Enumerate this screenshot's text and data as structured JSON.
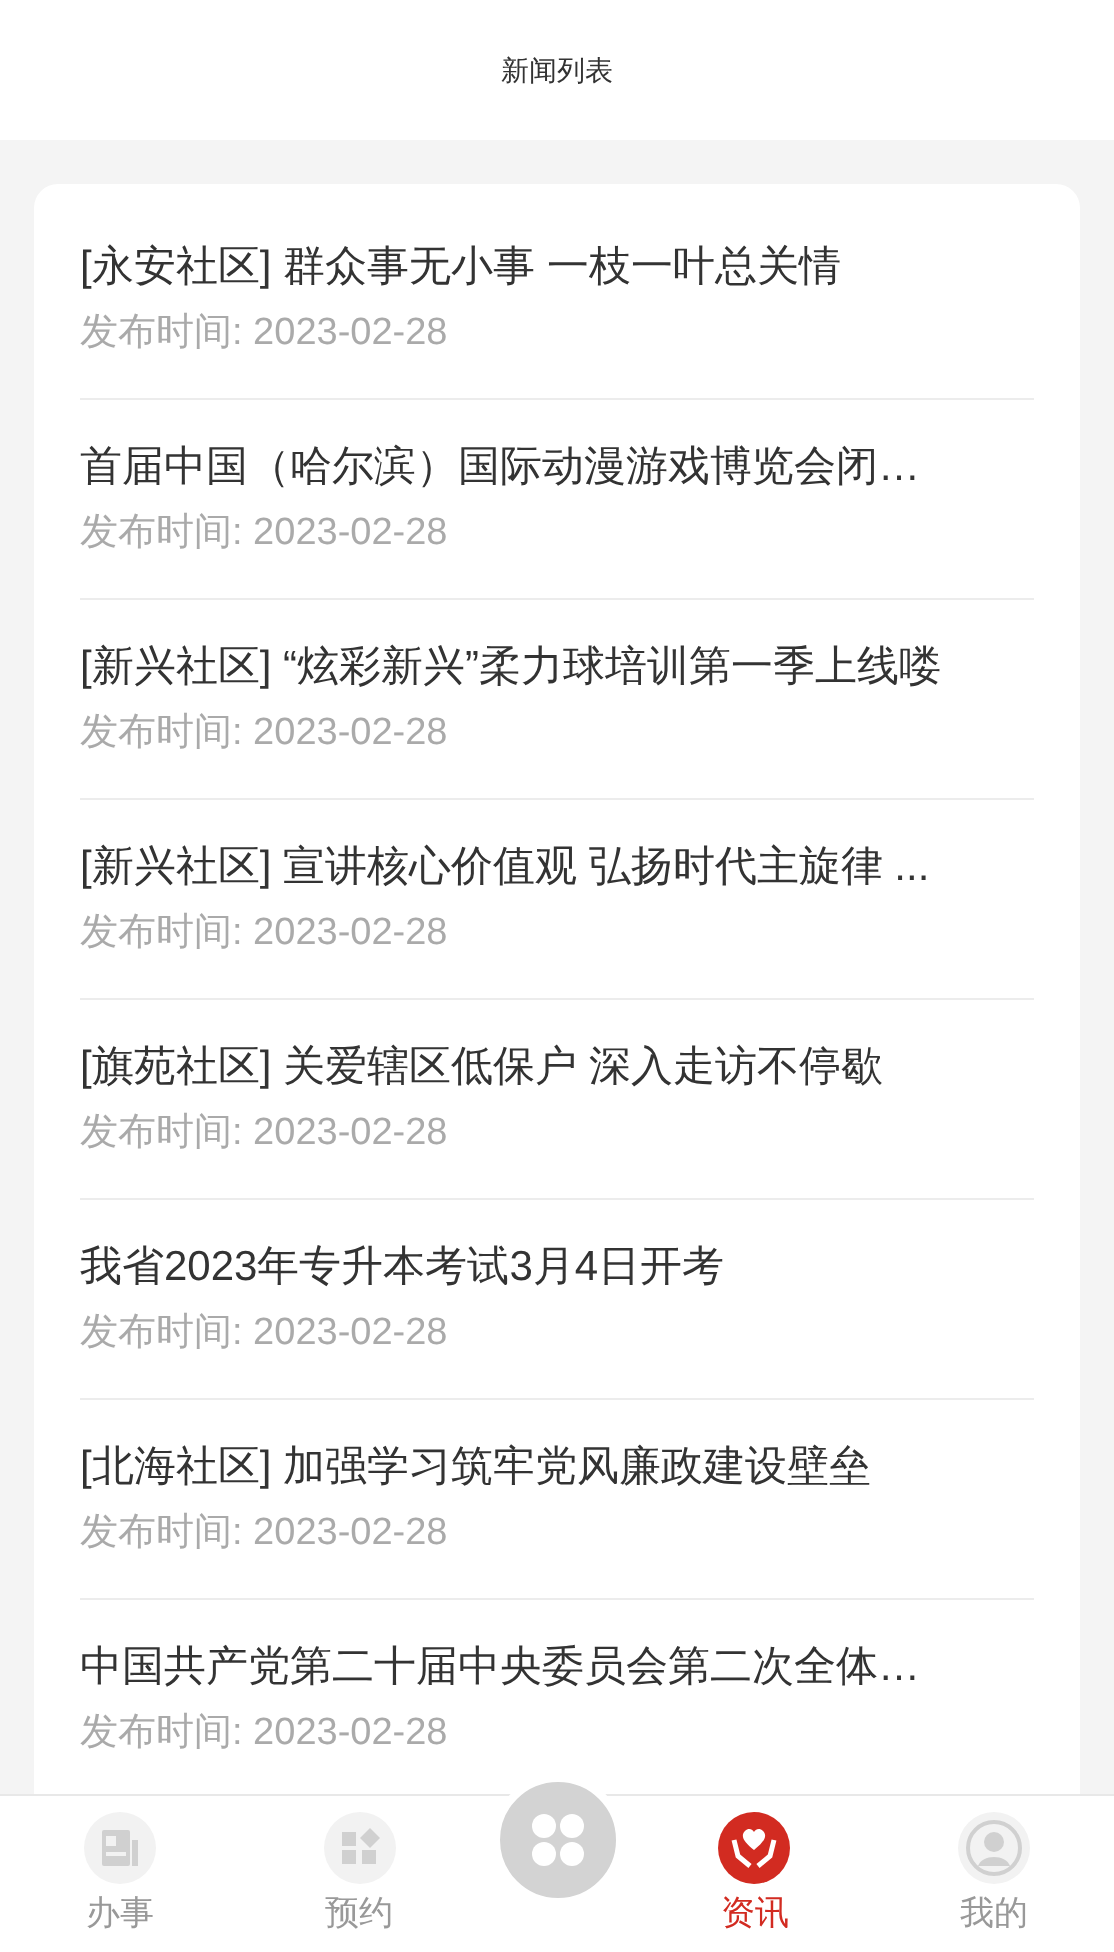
{
  "header": {
    "title": "新闻列表"
  },
  "news": [
    {
      "title": "[永安社区] 群众事无小事 一枝一叶总关情",
      "date": "发布时间: 2023-02-28"
    },
    {
      "title": "首届中国（哈尔滨）国际动漫游戏博览会闭…",
      "date": "发布时间: 2023-02-28"
    },
    {
      "title": "[新兴社区] “炫彩新兴”柔力球培训第一季上线喽",
      "date": "发布时间: 2023-02-28"
    },
    {
      "title": "[新兴社区] 宣讲核心价值观 弘扬时代主旋律 ...",
      "date": "发布时间: 2023-02-28"
    },
    {
      "title": "[旗苑社区] 关爱辖区低保户 深入走访不停歇",
      "date": "发布时间: 2023-02-28"
    },
    {
      "title": "我省2023年专升本考试3月4日开考",
      "date": "发布时间: 2023-02-28"
    },
    {
      "title": "[北海社区] 加强学习筑牢党风廉政建设壁垒",
      "date": "发布时间: 2023-02-28"
    },
    {
      "title": "中国共产党第二十届中央委员会第二次全体…",
      "date": "发布时间: 2023-02-28"
    }
  ],
  "tab_bar": [
    {
      "label": "办事",
      "selected": false
    },
    {
      "label": "预约",
      "selected": false
    },
    {
      "label": "资讯",
      "selected": true
    },
    {
      "label": "我的",
      "selected": false
    }
  ]
}
